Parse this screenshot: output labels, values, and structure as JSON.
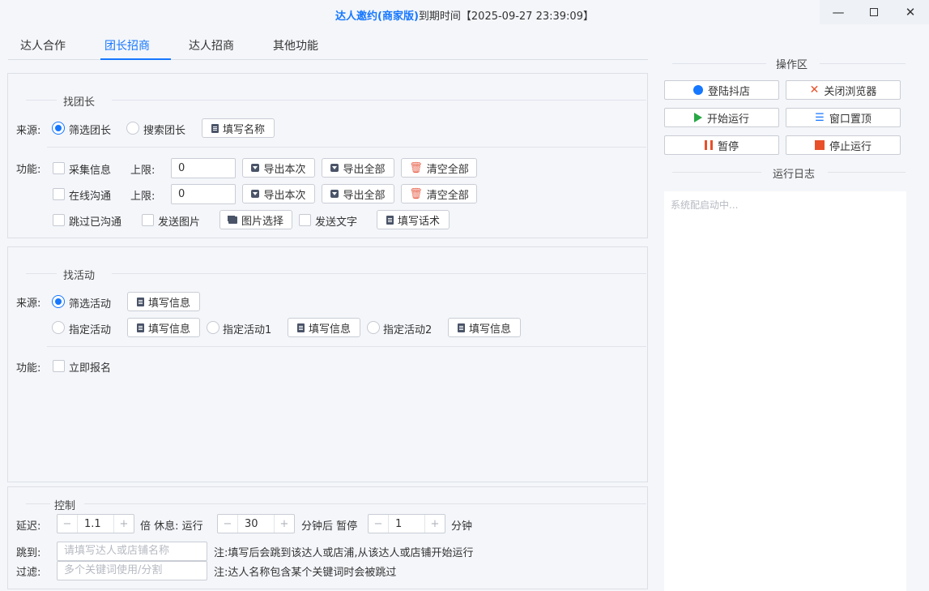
{
  "window": {
    "app_name": "达人邀约(商家版)",
    "expiry_text": "到期时间【2025-09-27 23:39:09】"
  },
  "tabs": [
    "达人合作",
    "团长招商",
    "达人招商",
    "其他功能"
  ],
  "active_tab": 1,
  "find_leader": {
    "title": "找团长",
    "source_label": "来源:",
    "radio_filter": "筛选团长",
    "radio_search": "搜索团长",
    "fill_name_btn": "填写名称",
    "function_label": "功能:",
    "collect_info": "采集信息",
    "online_chat": "在线沟通",
    "limit_label": "上限:",
    "collect_limit": "0",
    "chat_limit": "0",
    "export_current": "导出本次",
    "export_all": "导出全部",
    "clear_all": "清空全部",
    "skip_chatted": "跳过已沟通",
    "send_image": "发送图片",
    "choose_image": "图片选择",
    "send_text": "发送文字",
    "fill_script": "填写话术"
  },
  "find_activity": {
    "title": "找活动",
    "source_label": "来源:",
    "radio_filter": "筛选活动",
    "fill_info": "填写信息",
    "radio_specify": "指定活动",
    "radio_specify1": "指定活动1",
    "radio_specify2": "指定活动2",
    "function_label": "功能:",
    "signup_now": "立即报名"
  },
  "control": {
    "title": "控制",
    "delay_label": "延迟:",
    "delay_value": "1.1",
    "rest_text": "倍 休息: 运行",
    "run_minutes": "30",
    "pause_text": "分钟后 暂停",
    "pause_minutes": "1",
    "minute_text": "分钟",
    "jump_label": "跳到:",
    "jump_placeholder": "请填写达人或店铺名称",
    "jump_note": "注:填写后会跳到该达人或店浦,从该达人或店铺开始运行",
    "filter_label": "过滤:",
    "filter_placeholder": "多个关键词使用/分割",
    "filter_note": "注:达人名称包含某个关键词时会被跳过"
  },
  "operation": {
    "title": "操作区",
    "login": "登陆抖店",
    "close_browser": "关闭浏览器",
    "start": "开始运行",
    "pin_window": "窗口置顶",
    "pause": "暂停",
    "stop": "停止运行",
    "log_title": "运行日志",
    "log_text": "系统配启动中..."
  },
  "colors": {
    "accent": "#1677ff",
    "play": "#28a745",
    "pause": "#e8502a",
    "stop": "#e8502a",
    "close": "#e8502a"
  }
}
